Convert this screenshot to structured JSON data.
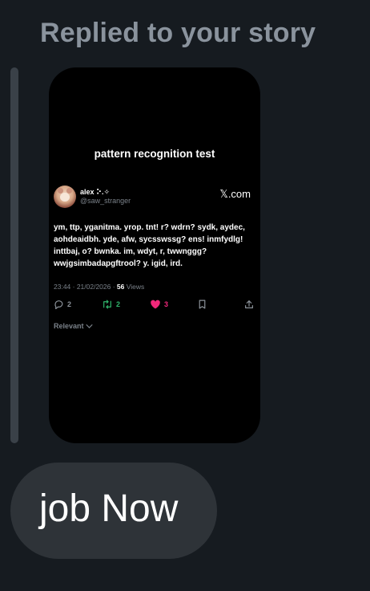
{
  "header": {
    "title": "Replied to your story"
  },
  "story": {
    "title": "pattern recognition test",
    "tweet": {
      "author_name": "alex ⠕.✧",
      "handle": "@saw_stranger",
      "brand": "𝕏.com",
      "text": "ym, ttp, yganitma. yrop. tnt! r? wdrn? sydk, aydec, aohdeaidbh. yde, afw, sycsswssg? ens! inmfydlg! inttbaj, o? bwnka. im, wdyt, r, twwnggg? wwjgsimbadapgftrool? y. igid, ird.",
      "datetime": "23:44 · 21/02/2026 · ",
      "views_count": "56",
      "views_label": " Views",
      "replies": "2",
      "retweets": "2",
      "likes": "3",
      "sort_label": "Relevant"
    }
  },
  "reply": {
    "text": "job Now"
  },
  "icons": {
    "reply": "comment-icon",
    "retweet": "retweet-icon",
    "like": "heart-icon",
    "bookmark": "bookmark-icon",
    "share": "share-icon",
    "sort": "chevron-down-icon"
  },
  "colors": {
    "background": "#161b20",
    "header_text": "#8a939d",
    "story_bg": "#000000",
    "retweet": "#2fb46b",
    "like": "#f0287a",
    "reply_bubble": "#2e3338"
  }
}
